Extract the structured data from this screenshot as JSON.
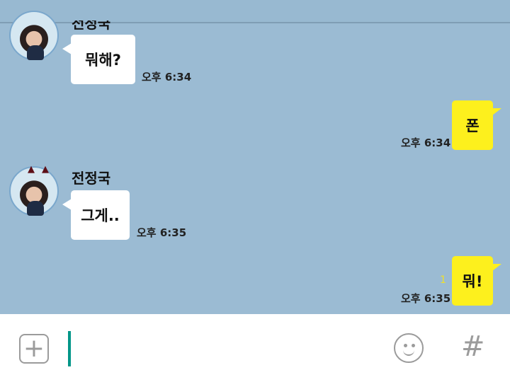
{
  "header": {
    "partial_name": "전정국"
  },
  "messages": [
    {
      "id": 1,
      "direction": "in",
      "sender": "전정국",
      "text": "뭐해?",
      "time": "오후 6:34"
    },
    {
      "id": 2,
      "direction": "out",
      "text": "폰",
      "time": "오후 6:34"
    },
    {
      "id": 3,
      "direction": "in",
      "sender": "전정국",
      "text": "그게..",
      "time": "오후 6:35"
    },
    {
      "id": 4,
      "direction": "out",
      "text": "뭐!",
      "time": "오후 6:35",
      "unread_count": "1"
    }
  ],
  "composer": {
    "input_value": "",
    "buttons": {
      "plus_icon": "+",
      "emoji_icon": "smiley-face",
      "hash_icon": "#"
    }
  },
  "colors": {
    "chat_background": "#9bbbd3",
    "incoming_bubble": "#ffffff",
    "outgoing_bubble": "#fdf01d",
    "cursor": "#009688"
  }
}
